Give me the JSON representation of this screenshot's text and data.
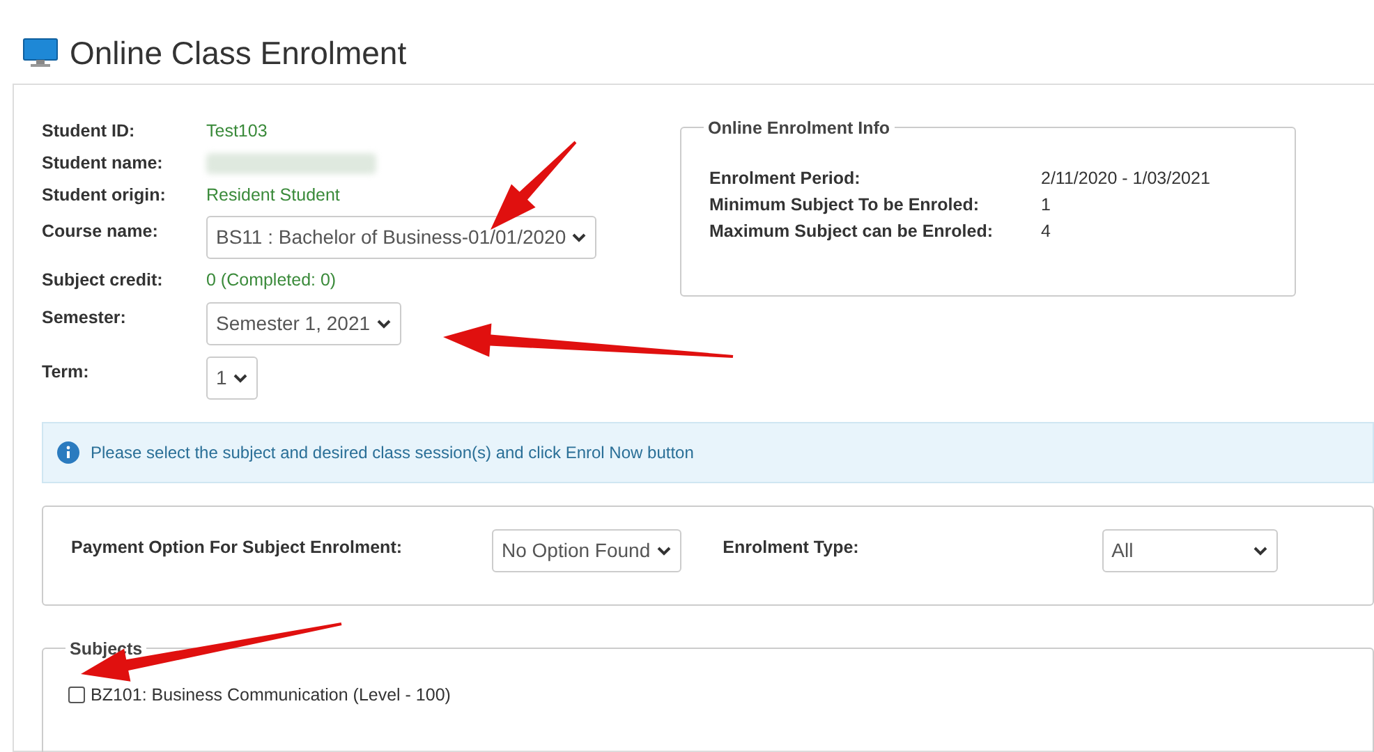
{
  "page_title": "Online Class Enrolment",
  "student_fields": [
    {
      "kind": "text",
      "label": "Student ID:",
      "value": "Test103"
    },
    {
      "kind": "redacted",
      "label": "Student name:"
    },
    {
      "kind": "text",
      "label": "Student origin:",
      "value": "Resident Student"
    },
    {
      "kind": "select",
      "label": "Course name:",
      "value": "BS11 : Bachelor of Business-01/01/2020"
    },
    {
      "kind": "text",
      "label": "Subject credit:",
      "value": "0 (Completed: 0)"
    },
    {
      "kind": "select",
      "label": "Semester:",
      "value": "Semester 1, 2021"
    },
    {
      "kind": "select",
      "label": "Term:",
      "value": "1"
    }
  ],
  "enrolment_info": {
    "title": "Online Enrolment Info",
    "rows": [
      {
        "label": "Enrolment Period:",
        "value": "2/11/2020 - 1/03/2021"
      },
      {
        "label": "Minimum Subject To be Enroled:",
        "value": "1"
      },
      {
        "label": "Maximum Subject can be Enroled:",
        "value": "4"
      }
    ]
  },
  "alert": "Please select the subject and desired class session(s) and click Enrol Now button",
  "payment_option": {
    "label": "Payment Option For Subject Enrolment:",
    "value": "No Option Found"
  },
  "enrolment_type": {
    "label": "Enrolment Type:",
    "value": "All"
  },
  "subjects": {
    "legend": "Subjects",
    "items": [
      {
        "label": "BZ101: Business Communication (Level - 100)",
        "checked": false
      }
    ]
  }
}
